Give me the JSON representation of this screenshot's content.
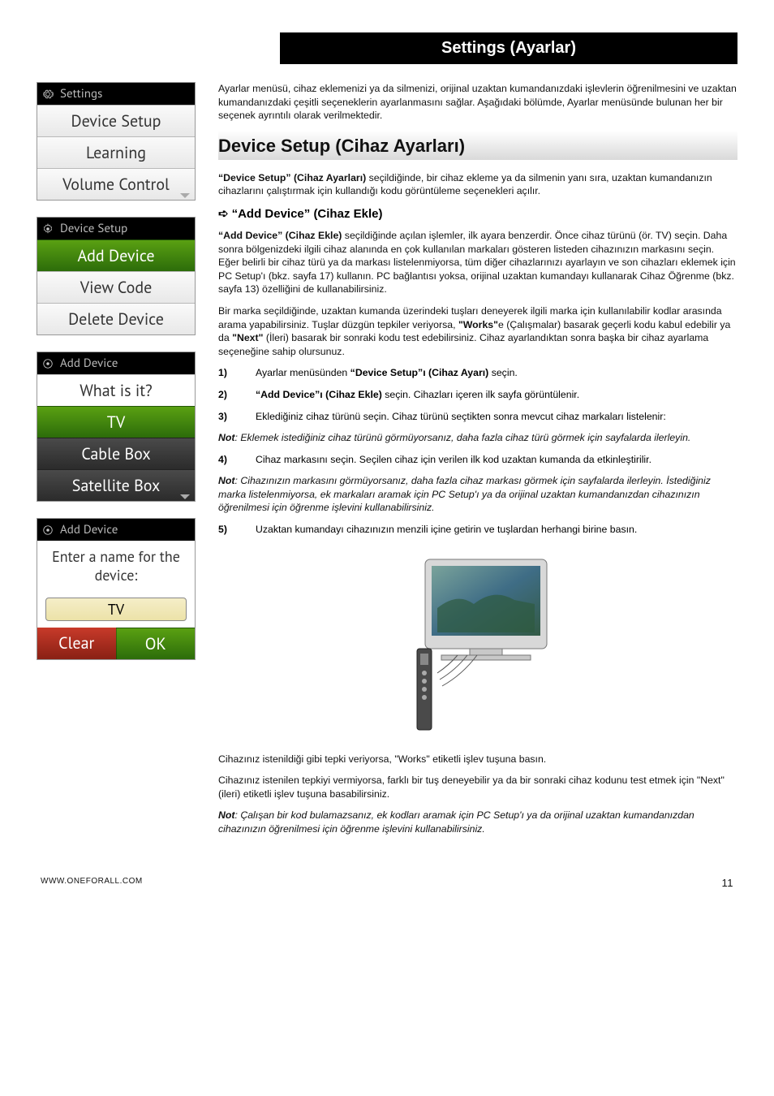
{
  "titlebar": "Settings (Ayarlar)",
  "menus": {
    "settings": {
      "header": "Settings",
      "items": [
        "Device Setup",
        "Learning",
        "Volume Control"
      ]
    },
    "device_setup": {
      "header": "Device Setup",
      "items": [
        "Add Device",
        "View Code",
        "Delete Device"
      ]
    },
    "add_device_type": {
      "header": "Add Device",
      "prompt": "What is it?",
      "items": [
        "TV",
        "Cable Box",
        "Satellite Box"
      ]
    },
    "add_device_name": {
      "header": "Add Device",
      "prompt": "Enter a name for the device:",
      "input_value": "TV",
      "clear": "Clear",
      "ok": "OK"
    }
  },
  "intro": "Ayarlar menüsü, cihaz eklemenizi ya da silmenizi, orijinal uzaktan kumandanızdaki işlevlerin öğrenilmesini ve uzaktan kumandanızdaki çeşitli seçeneklerin ayarlanmasını sağlar. Aşağıdaki bölümde, Ayarlar menüsünde bulunan her bir seçenek ayrıntılı olarak verilmektedir.",
  "h2": "Device Setup (Cihaz Ayarları)",
  "ds_intro_lead": "“Device Setup” (Cihaz Ayarları)",
  "ds_intro_rest": " seçildiğinde, bir cihaz ekleme ya da silmenin yanı sıra, uzaktan kumandanızın cihazlarını çalıştırmak için kullandığı kodu görüntüleme seçenekleri açılır.",
  "h3_icon": "➪",
  "h3": "“Add Device” (Cihaz Ekle)",
  "ad_p1_lead": "“Add Device” (Cihaz Ekle)",
  "ad_p1_rest": " seçildiğinde açılan işlemler, ilk ayara benzerdir. Önce cihaz türünü (ör. TV) seçin. Daha sonra bölgenizdeki ilgili cihaz alanında en çok kullanılan markaları gösteren listeden cihazınızın markasını seçin. Eğer belirli bir cihaz türü ya da markası listelenmiyorsa, tüm diğer cihazlarınızı ayarlayın ve son cihazları eklemek için PC Setup'ı (bkz. sayfa 17) kullanın. PC bağlantısı yoksa, orijinal uzaktan kumandayı kullanarak Cihaz Öğrenme (bkz. sayfa 13) özelliğini de kullanabilirsiniz.",
  "ad_p2_a": "Bir marka seçildiğinde, uzaktan kumanda üzerindeki tuşları deneyerek ilgili marka için kullanılabilir kodlar arasında arama yapabilirsiniz. Tuşlar düzgün tepkiler veriyorsa, ",
  "ad_p2_b1": "\"Works\"",
  "ad_p2_c": "e (Çalışmalar) basarak geçerli kodu kabul edebilir ya da ",
  "ad_p2_b2": "\"Next\"",
  "ad_p2_d": " (İleri) basarak bir sonraki kodu test edebilirsiniz. Cihaz ayarlandıktan sonra başka bir cihaz ayarlama seçeneğine sahip olursunuz.",
  "steps": {
    "s1_a": "Ayarlar menüsünden ",
    "s1_b": "“Device Setup”ı (Cihaz Ayarı)",
    "s1_c": " seçin.",
    "s2_a": "“Add Device”ı (Cihaz Ekle)",
    "s2_b": " seçin. Cihazları içeren ilk sayfa görüntülenir.",
    "s3": "Eklediğiniz cihaz türünü seçin. Cihaz türünü seçtikten sonra mevcut cihaz markaları listelenir:",
    "s4": "Cihaz markasını seçin. Seçilen cihaz için verilen ilk kod uzaktan kumanda da etkinleştirilir.",
    "s5": "Uzaktan kumandayı cihazınızın menzili içine getirin ve tuşlardan herhangi birine basın."
  },
  "note1_b": "Not",
  "note1_t": ": Eklemek istediğiniz cihaz türünü görmüyorsanız, daha fazla cihaz türü görmek için sayfalarda ilerleyin.",
  "note2_b": "Not",
  "note2_t": ": Cihazınızın markasını görmüyorsanız, daha fazla cihaz markası görmek için sayfalarda ilerleyin. İstediğiniz marka listelenmiyorsa, ek markaları aramak için PC Setup'ı ya da orijinal uzaktan kumandanızdan cihazınızın öğrenilmesi için öğrenme işlevini kullanabilirsiniz.",
  "after1": "Cihazınız istenildiği gibi tepki veriyorsa, \"Works\" etiketli işlev tuşuna basın.",
  "after2": "Cihazınız istenilen tepkiyi vermiyorsa, farklı bir tuş deneyebilir ya da bir sonraki cihaz kodunu test etmek için \"Next\" (ileri) etiketli işlev tuşuna basabilirsiniz.",
  "note3_b": "Not",
  "note3_t": ": Çalışan bir kod bulamazsanız, ek kodları aramak için PC Setup'ı ya da orijinal uzaktan kumandanızdan cihazınızın öğrenilmesi için öğrenme işlevini kullanabilirsiniz.",
  "footer_url": "WWW.ONEFORALL.COM",
  "footer_page": "11"
}
